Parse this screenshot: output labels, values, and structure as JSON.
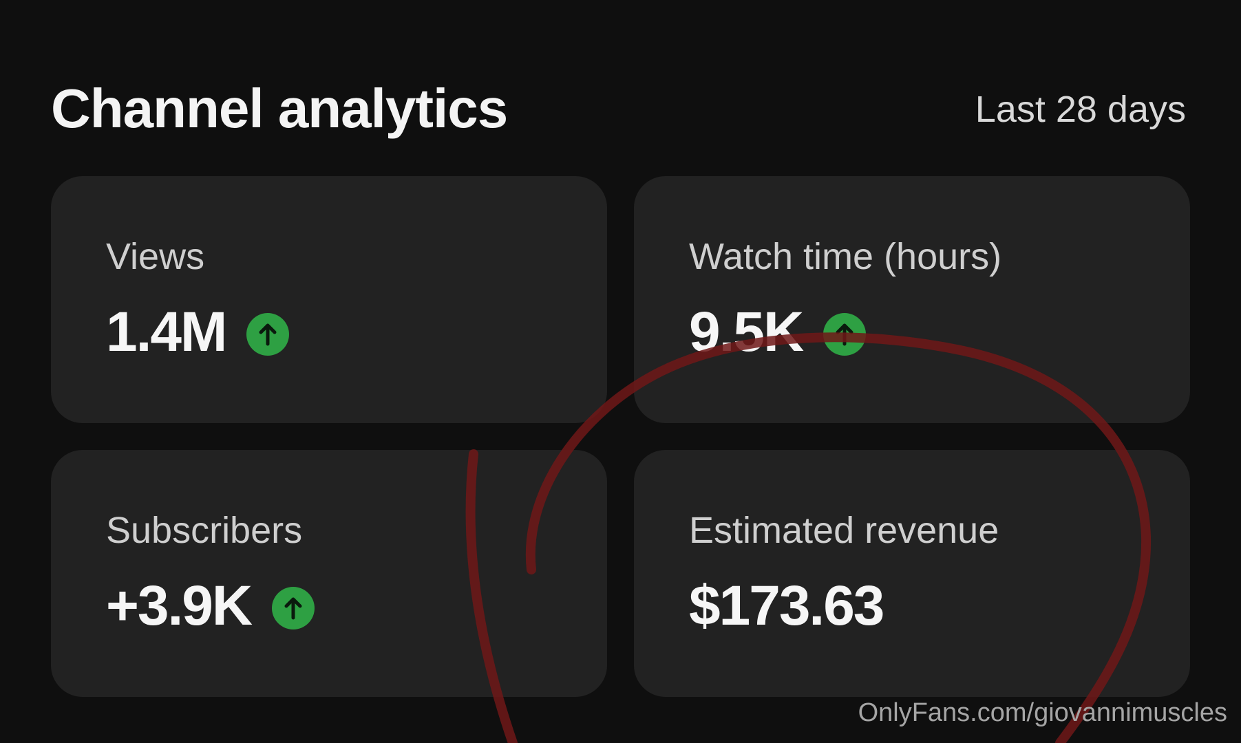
{
  "header": {
    "title": "Channel analytics",
    "period_label": "Last 28 days"
  },
  "metrics": [
    {
      "label": "Views",
      "value": "1.4M",
      "trend": "up"
    },
    {
      "label": "Watch time (hours)",
      "value": "9.5K",
      "trend": "up"
    },
    {
      "label": "Subscribers",
      "value": "+3.9K",
      "trend": "up"
    },
    {
      "label": "Estimated revenue",
      "value": "$173.63",
      "trend": "none"
    }
  ],
  "watermark": "OnlyFans.com/giovannimuscles",
  "colors": {
    "background": "#0f0f0f",
    "card": "#222222",
    "trend_up": "#2ea043",
    "annotation": "#7a1a1a"
  },
  "icons": {
    "trend_up": "arrow-up-circle-icon"
  }
}
